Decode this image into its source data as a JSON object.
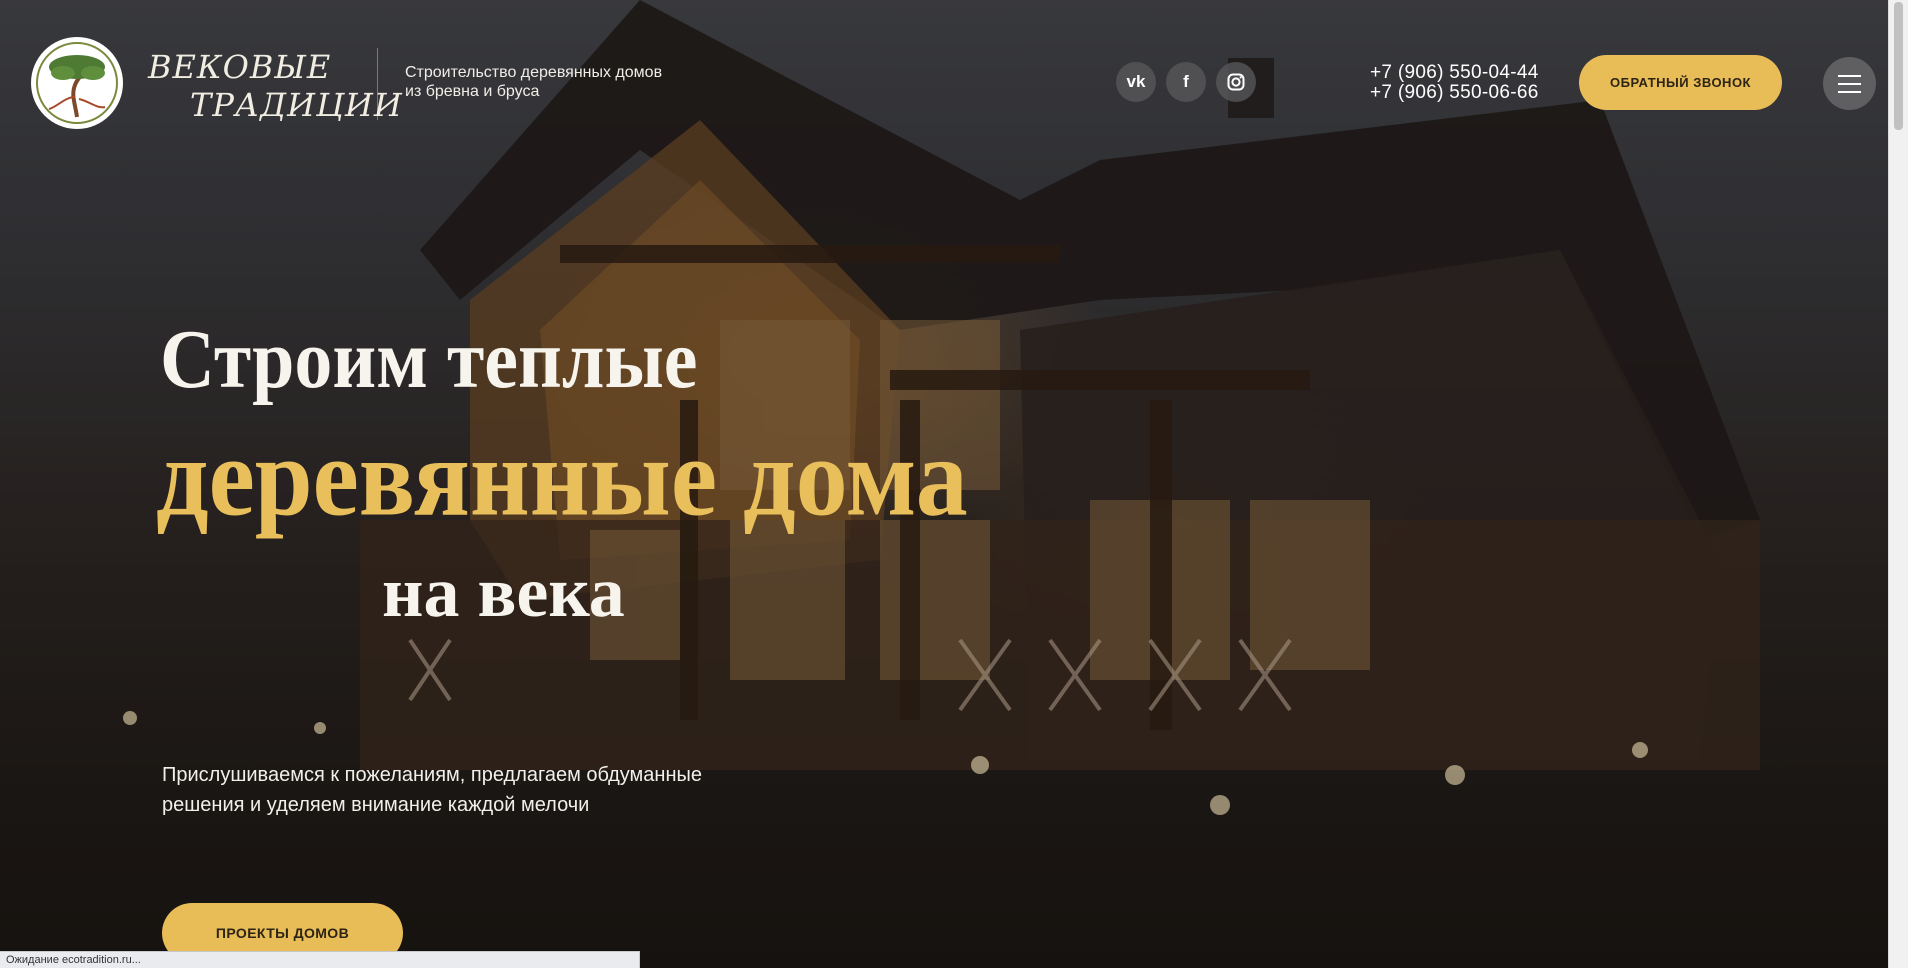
{
  "header": {
    "logo_line1": "ВЕКОВЫЕ",
    "logo_line2": "ТРАДИЦИИ",
    "tagline": "Строительство деревянных домов из бревна и бруса",
    "socials": [
      {
        "icon": "vk-icon",
        "glyph": "vk"
      },
      {
        "icon": "facebook-icon",
        "glyph": "f"
      },
      {
        "icon": "instagram-icon",
        "glyph": ""
      }
    ],
    "phones": [
      "+7 (906) 550-04-44",
      "+7 (906) 550-06-66"
    ],
    "callback_label": "ОБРАТНЫЙ ЗВОНОК"
  },
  "hero": {
    "title_line1": "Строим теплые",
    "title_line2": "деревянные дома",
    "title_line3": "на века",
    "description": "Прислушиваемся к пожеланиям, предлагаем обдуманные решения и уделяем внимание каждой мелочи",
    "projects_label": "ПРОЕКТЫ ДОМОВ"
  },
  "status_bar": {
    "text": "Ожидание ecotradition.ru..."
  },
  "colors": {
    "accent": "#e8bc57",
    "title_gold": "#e9bf5c"
  }
}
